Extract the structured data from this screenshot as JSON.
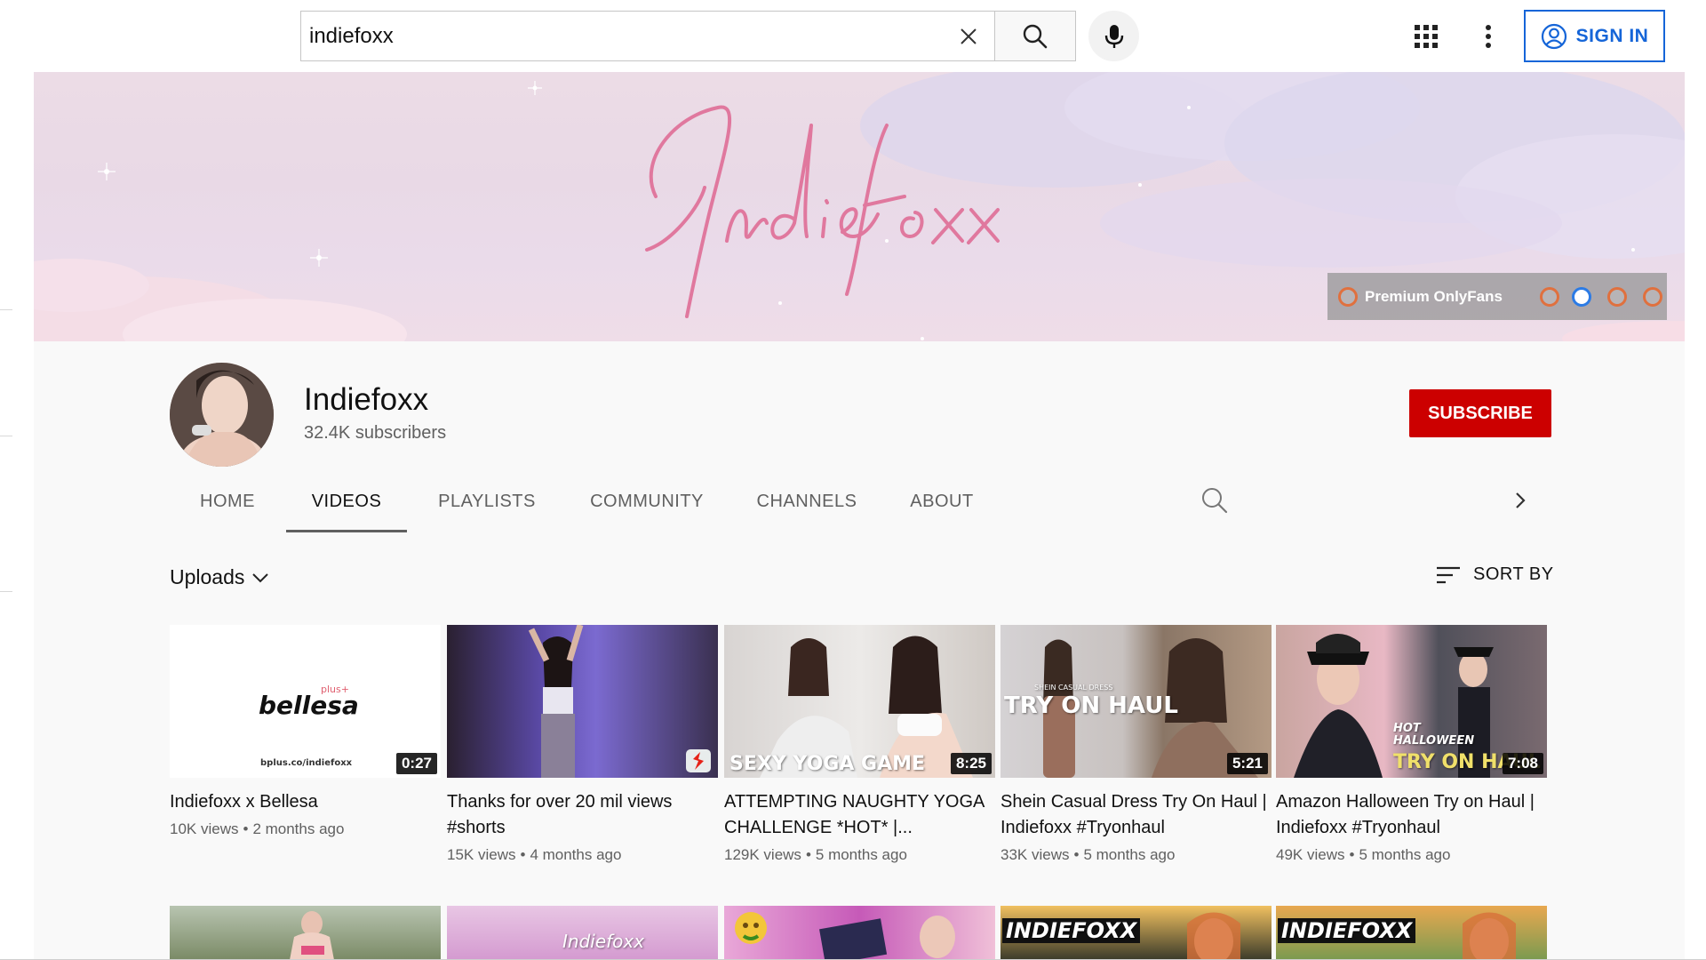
{
  "search": {
    "query": "indiefoxx"
  },
  "header": {
    "sign_in_label": "SIGN IN"
  },
  "banner": {
    "signature": "Indiefoxx",
    "link_label": "Premium OnlyFans"
  },
  "channel": {
    "name": "Indiefoxx",
    "subscribers": "32.4K subscribers",
    "subscribe_label": "SUBSCRIBE"
  },
  "tabs": [
    {
      "label": "HOME",
      "active": false
    },
    {
      "label": "VIDEOS",
      "active": true
    },
    {
      "label": "PLAYLISTS",
      "active": false
    },
    {
      "label": "COMMUNITY",
      "active": false
    },
    {
      "label": "CHANNELS",
      "active": false
    },
    {
      "label": "ABOUT",
      "active": false
    }
  ],
  "section": {
    "uploads_label": "Uploads",
    "sort_label": "SORT BY"
  },
  "videos": [
    {
      "title": "Indiefoxx x Bellesa",
      "views": "10K views",
      "age": "2 months ago",
      "duration": "0:27",
      "thumb_text": "bellesa",
      "thumb_sup": "plus+",
      "thumb_url": "bplus.co/indiefoxx"
    },
    {
      "title": "Thanks for over 20 mil views #shorts",
      "views": "15K views",
      "age": "4 months ago",
      "duration": ""
    },
    {
      "title": "ATTEMPTING NAUGHTY YOGA CHALLENGE *HOT* |...",
      "views": "129K views",
      "age": "5 months ago",
      "duration": "8:25",
      "thumb_text": "SEXY YOGA GAME"
    },
    {
      "title": "Shein Casual Dress Try On Haul | Indiefoxx #Tryonhaul",
      "views": "33K views",
      "age": "5 months ago",
      "duration": "5:21",
      "thumb_text": "TRY ON HAUL",
      "thumb_small": "SHEIN CASUAL DRESS"
    },
    {
      "title": "Amazon Halloween Try on Haul | Indiefoxx #Tryonhaul",
      "views": "49K views",
      "age": "5 months ago",
      "duration": "7:08",
      "thumb_text": "TRY ON HAUL",
      "thumb_small": "HOT HALLOWEEN"
    }
  ],
  "row2": [
    {
      "thumb_text": ""
    },
    {
      "thumb_text": "Indiefoxx"
    },
    {
      "thumb_text": ""
    },
    {
      "thumb_text": "INDIEFOXX"
    },
    {
      "thumb_text": "INDIEFOXX"
    }
  ],
  "colors": {
    "accent_blue": "#1565d8",
    "subscribe_red": "#cc0000",
    "muted_text": "#606060"
  },
  "icons": [
    "clear-icon",
    "search-icon",
    "mic-icon",
    "apps-grid-icon",
    "more-vert-icon",
    "account-circle-icon",
    "chevron-down-icon",
    "sort-icon",
    "chevron-right-icon",
    "shorts-icon"
  ]
}
